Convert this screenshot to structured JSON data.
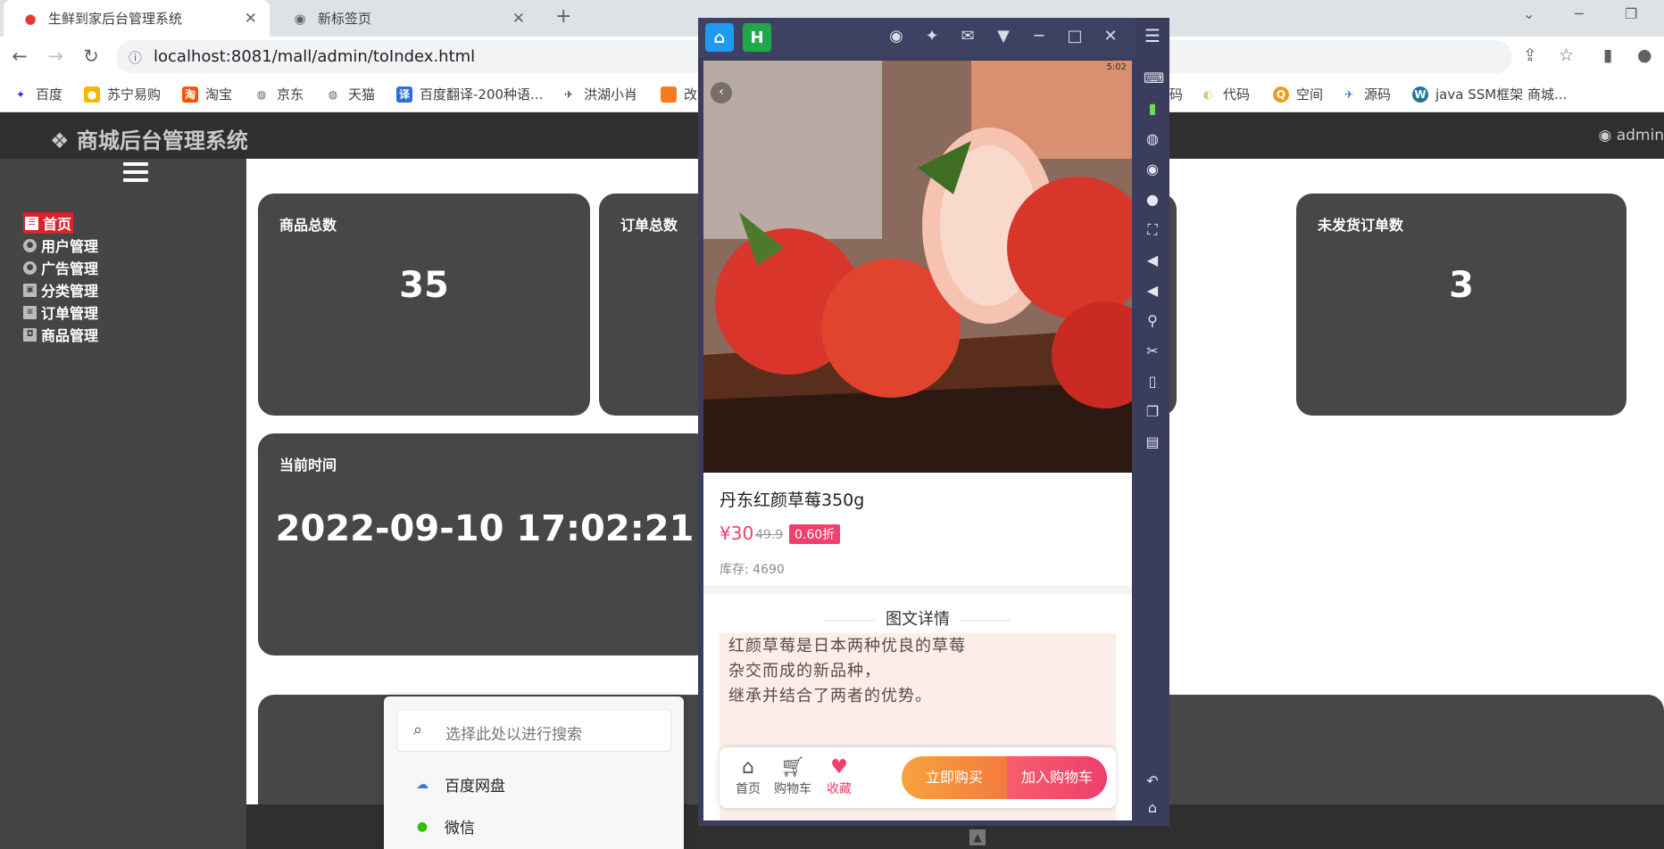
{
  "browser": {
    "tabs": [
      {
        "title": "生鲜到家后台管理系统",
        "favicon": "apple-icon"
      },
      {
        "title": "新标签页",
        "favicon": "chrome-icon"
      }
    ],
    "new_tab": "+",
    "url": "localhost:8081/mall/admin/toIndex.html",
    "bookmarks": [
      "百度",
      "苏宁易购",
      "淘宝",
      "京东",
      "天猫",
      "百度翻译-200种语...",
      "洪湖小肖",
      "改",
      "码",
      "代码",
      "空间",
      "源码",
      "java SSM框架 商城..."
    ]
  },
  "admin": {
    "brand": "商城后台管理系统",
    "user": "admin",
    "menu": [
      "首页",
      "用户管理",
      "广告管理",
      "分类管理",
      "订单管理",
      "商品管理"
    ],
    "cards": [
      {
        "title": "商品总数",
        "value": "35"
      },
      {
        "title": "订单总数",
        "value": ""
      },
      {
        "title": "未发货订单数",
        "value": "3"
      },
      {
        "title": "当前时间",
        "value": "2022-09-10 17:02:21"
      }
    ]
  },
  "popup": {
    "placeholder": "选择此处以进行搜索",
    "items": [
      "百度网盘",
      "微信"
    ]
  },
  "emulator": {
    "apps": [
      "home-icon",
      "H"
    ],
    "status_time": "5:02",
    "product": {
      "name": "丹东红颜草莓350g",
      "price": "¥30",
      "old_price": "49.9",
      "discount": "0.60折",
      "stock": "库存: 4690"
    },
    "detail": {
      "title": "图文详情",
      "lines": [
        "红颜草莓是日本两种优良的草莓",
        "杂交而成的新品种，",
        "继承并结合了两者的优势。"
      ]
    },
    "actions": {
      "home": "首页",
      "cart": "购物车",
      "favorite": "收藏",
      "buy_now": "立即购买",
      "add_cart": "加入购物车"
    }
  }
}
